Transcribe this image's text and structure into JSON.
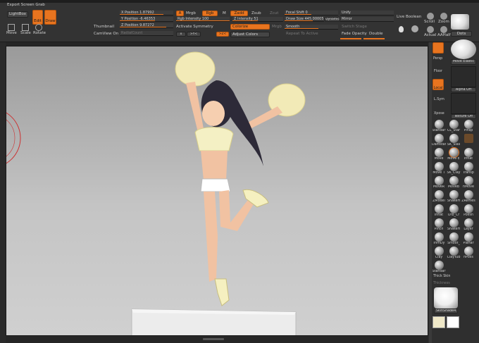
{
  "top_left": {
    "export": "Export Screen Grab",
    "lightbox": "LightBox",
    "edit": "Edit",
    "draw": "Draw",
    "move": "Move",
    "scale": "Scale",
    "rotate": "Rotate"
  },
  "side_labels": {
    "thumbnail": "Thumbnail",
    "camview": "CamView On"
  },
  "position": {
    "x": "X Position 1.87992",
    "y": "Y Position -6.46353",
    "z": "Z Position 9.87272",
    "radial": "RadialCount"
  },
  "color": {
    "a": "A",
    "mrgb": "Mrgb",
    "rgb": "Rgb",
    "m": "M",
    "zadd": "Zadd",
    "zsub": "Zsub",
    "zcut": "Zcut"
  },
  "rgb_intensity": "Rgb Intensity 100",
  "z_intensity": "Z Intensity 51",
  "symmetry": {
    "activate": "Activate Symmetry",
    "colorize": "Colorize",
    "adjust_colors": "Adjust Colors",
    "mrgb_btn": "Mrgb",
    "axes": [
      "x",
      ">Y<",
      ">Z<"
    ]
  },
  "focal": {
    "shift": "Focal Shift 0",
    "draw_size": "Draw Size 445.00005",
    "dynamic": "Dynamic",
    "smooth": "Smooth",
    "repeat": "Repeat To Active"
  },
  "unify": {
    "unify": "Unify",
    "mirror": "Mirror",
    "switch_stage": "Switch Stage",
    "fade_opacity": "Fade Opacity",
    "double": "Double"
  },
  "live_boolean": "Live Boolean",
  "right_top": {
    "scroll": "Scroll",
    "zoom": "Zoom",
    "actual": "Actual",
    "aahalf": "AAHalf",
    "dots": "Dots"
  },
  "right_panel": {
    "persp": "Persp",
    "floor": "Floor",
    "local": "Local",
    "lsym": "L.Sym",
    "xpose": "Xpose",
    "alpha": "Alpha Off",
    "texture": "Texture Off",
    "brush": "Move Elastic",
    "thick_skin": "Thick Skin",
    "thickness": "Thickness",
    "material": "SkinShade4"
  },
  "brushes": [
    "Standar",
    "CL_Star",
    "Pinsp",
    "Damstand",
    "SK_Slas",
    "",
    "Move",
    "Move E",
    "Inflat",
    "Move T",
    "SK_Clay",
    "Transp",
    "MoveR",
    "MoveB",
    "hMove",
    "ZModel",
    "SnakeH",
    "ZRemes",
    "Inflat",
    "Orb_Cr",
    "Polish",
    "Pinch",
    "SnakeH",
    "Layer",
    "TrimDy",
    "Smoot_",
    "Planar",
    "Clay",
    "ClayTub",
    "hPolis",
    "Standar"
  ],
  "colors": {
    "accent": "#e8741f",
    "panel": "#333333",
    "canvas_top": "#9a9a9a",
    "canvas_bottom": "#d0d0d0"
  }
}
